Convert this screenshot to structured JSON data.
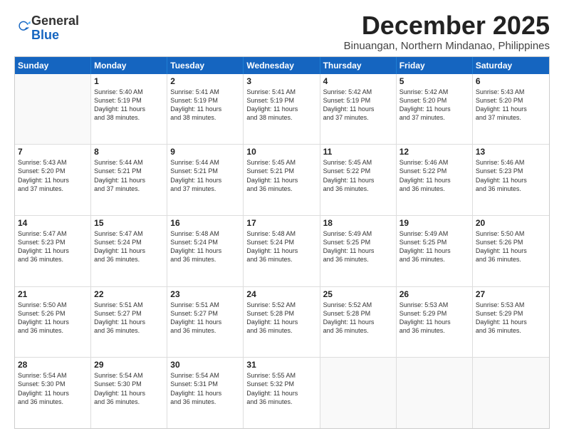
{
  "logo": {
    "general": "General",
    "blue": "Blue"
  },
  "header": {
    "month": "December 2025",
    "location": "Binuangan, Northern Mindanao, Philippines"
  },
  "weekdays": [
    "Sunday",
    "Monday",
    "Tuesday",
    "Wednesday",
    "Thursday",
    "Friday",
    "Saturday"
  ],
  "rows": [
    [
      {
        "day": "",
        "info": ""
      },
      {
        "day": "1",
        "info": "Sunrise: 5:40 AM\nSunset: 5:19 PM\nDaylight: 11 hours\nand 38 minutes."
      },
      {
        "day": "2",
        "info": "Sunrise: 5:41 AM\nSunset: 5:19 PM\nDaylight: 11 hours\nand 38 minutes."
      },
      {
        "day": "3",
        "info": "Sunrise: 5:41 AM\nSunset: 5:19 PM\nDaylight: 11 hours\nand 38 minutes."
      },
      {
        "day": "4",
        "info": "Sunrise: 5:42 AM\nSunset: 5:19 PM\nDaylight: 11 hours\nand 37 minutes."
      },
      {
        "day": "5",
        "info": "Sunrise: 5:42 AM\nSunset: 5:20 PM\nDaylight: 11 hours\nand 37 minutes."
      },
      {
        "day": "6",
        "info": "Sunrise: 5:43 AM\nSunset: 5:20 PM\nDaylight: 11 hours\nand 37 minutes."
      }
    ],
    [
      {
        "day": "7",
        "info": "Sunrise: 5:43 AM\nSunset: 5:20 PM\nDaylight: 11 hours\nand 37 minutes."
      },
      {
        "day": "8",
        "info": "Sunrise: 5:44 AM\nSunset: 5:21 PM\nDaylight: 11 hours\nand 37 minutes."
      },
      {
        "day": "9",
        "info": "Sunrise: 5:44 AM\nSunset: 5:21 PM\nDaylight: 11 hours\nand 37 minutes."
      },
      {
        "day": "10",
        "info": "Sunrise: 5:45 AM\nSunset: 5:21 PM\nDaylight: 11 hours\nand 36 minutes."
      },
      {
        "day": "11",
        "info": "Sunrise: 5:45 AM\nSunset: 5:22 PM\nDaylight: 11 hours\nand 36 minutes."
      },
      {
        "day": "12",
        "info": "Sunrise: 5:46 AM\nSunset: 5:22 PM\nDaylight: 11 hours\nand 36 minutes."
      },
      {
        "day": "13",
        "info": "Sunrise: 5:46 AM\nSunset: 5:23 PM\nDaylight: 11 hours\nand 36 minutes."
      }
    ],
    [
      {
        "day": "14",
        "info": "Sunrise: 5:47 AM\nSunset: 5:23 PM\nDaylight: 11 hours\nand 36 minutes."
      },
      {
        "day": "15",
        "info": "Sunrise: 5:47 AM\nSunset: 5:24 PM\nDaylight: 11 hours\nand 36 minutes."
      },
      {
        "day": "16",
        "info": "Sunrise: 5:48 AM\nSunset: 5:24 PM\nDaylight: 11 hours\nand 36 minutes."
      },
      {
        "day": "17",
        "info": "Sunrise: 5:48 AM\nSunset: 5:24 PM\nDaylight: 11 hours\nand 36 minutes."
      },
      {
        "day": "18",
        "info": "Sunrise: 5:49 AM\nSunset: 5:25 PM\nDaylight: 11 hours\nand 36 minutes."
      },
      {
        "day": "19",
        "info": "Sunrise: 5:49 AM\nSunset: 5:25 PM\nDaylight: 11 hours\nand 36 minutes."
      },
      {
        "day": "20",
        "info": "Sunrise: 5:50 AM\nSunset: 5:26 PM\nDaylight: 11 hours\nand 36 minutes."
      }
    ],
    [
      {
        "day": "21",
        "info": "Sunrise: 5:50 AM\nSunset: 5:26 PM\nDaylight: 11 hours\nand 36 minutes."
      },
      {
        "day": "22",
        "info": "Sunrise: 5:51 AM\nSunset: 5:27 PM\nDaylight: 11 hours\nand 36 minutes."
      },
      {
        "day": "23",
        "info": "Sunrise: 5:51 AM\nSunset: 5:27 PM\nDaylight: 11 hours\nand 36 minutes."
      },
      {
        "day": "24",
        "info": "Sunrise: 5:52 AM\nSunset: 5:28 PM\nDaylight: 11 hours\nand 36 minutes."
      },
      {
        "day": "25",
        "info": "Sunrise: 5:52 AM\nSunset: 5:28 PM\nDaylight: 11 hours\nand 36 minutes."
      },
      {
        "day": "26",
        "info": "Sunrise: 5:53 AM\nSunset: 5:29 PM\nDaylight: 11 hours\nand 36 minutes."
      },
      {
        "day": "27",
        "info": "Sunrise: 5:53 AM\nSunset: 5:29 PM\nDaylight: 11 hours\nand 36 minutes."
      }
    ],
    [
      {
        "day": "28",
        "info": "Sunrise: 5:54 AM\nSunset: 5:30 PM\nDaylight: 11 hours\nand 36 minutes."
      },
      {
        "day": "29",
        "info": "Sunrise: 5:54 AM\nSunset: 5:30 PM\nDaylight: 11 hours\nand 36 minutes."
      },
      {
        "day": "30",
        "info": "Sunrise: 5:54 AM\nSunset: 5:31 PM\nDaylight: 11 hours\nand 36 minutes."
      },
      {
        "day": "31",
        "info": "Sunrise: 5:55 AM\nSunset: 5:32 PM\nDaylight: 11 hours\nand 36 minutes."
      },
      {
        "day": "",
        "info": ""
      },
      {
        "day": "",
        "info": ""
      },
      {
        "day": "",
        "info": ""
      }
    ]
  ]
}
